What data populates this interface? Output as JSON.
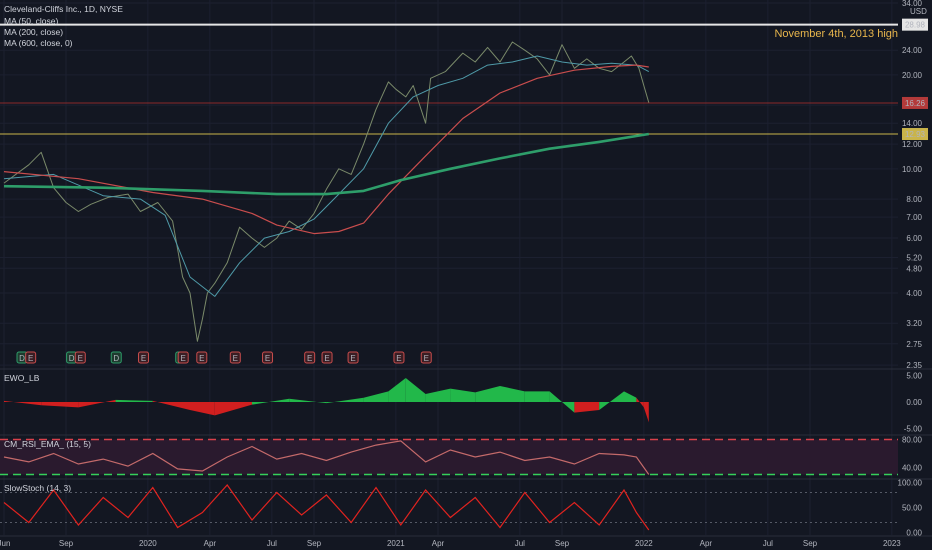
{
  "main": {
    "title": "Cleveland-Cliffs Inc., 1D, NYSE",
    "indicators": [
      "MA (50, close)",
      "MA (200, close)",
      "MA (600, close, 0)"
    ],
    "currency": "USD",
    "annotation": "November 4th, 2013 high",
    "price_tags": {
      "high_line": "28.98",
      "current": "16.26",
      "support": "12.93"
    },
    "event_markers": [
      {
        "t": 0.0,
        "label": "D"
      },
      {
        "t": 0.035,
        "label": "E"
      },
      {
        "t": 0.2,
        "label": "D"
      },
      {
        "t": 0.235,
        "label": "E"
      },
      {
        "t": 0.38,
        "label": "D"
      },
      {
        "t": 0.49,
        "label": "E"
      },
      {
        "t": 0.64,
        "label": "D"
      },
      {
        "t": 0.65,
        "label": "E"
      },
      {
        "t": 0.725,
        "label": "E"
      },
      {
        "t": 0.86,
        "label": "E"
      },
      {
        "t": 0.99,
        "label": "E"
      },
      {
        "t": 1.16,
        "label": "E"
      },
      {
        "t": 1.23,
        "label": "E"
      },
      {
        "t": 1.335,
        "label": "E"
      },
      {
        "t": 1.52,
        "label": "E"
      },
      {
        "t": 1.63,
        "label": "E"
      }
    ]
  },
  "panes": [
    {
      "title": "EWO_LB",
      "ticks": [
        "5.00",
        "0.00",
        "-5.00"
      ]
    },
    {
      "title": "CM_RSI_EMA_ (15, 5)",
      "ticks": [
        "80.00",
        "40.00"
      ]
    },
    {
      "title": "SlowStoch (14, 3)",
      "ticks": [
        "100.00",
        "50.00",
        "0.00"
      ]
    }
  ],
  "time_axis": [
    {
      "t": 0.0,
      "label": "Jun"
    },
    {
      "t": 0.25,
      "label": "Sep"
    },
    {
      "t": 0.58,
      "label": "2020"
    },
    {
      "t": 0.83,
      "label": "Apr"
    },
    {
      "t": 1.08,
      "label": "Jul"
    },
    {
      "t": 1.25,
      "label": "Sep"
    },
    {
      "t": 1.58,
      "label": "2021"
    },
    {
      "t": 1.75,
      "label": "Apr"
    },
    {
      "t": 2.08,
      "label": "Jul"
    },
    {
      "t": 2.25,
      "label": "Sep"
    },
    {
      "t": 2.58,
      "label": "2022"
    },
    {
      "t": 2.83,
      "label": "Apr"
    },
    {
      "t": 3.08,
      "label": "Jul"
    },
    {
      "t": 3.25,
      "label": "Sep"
    },
    {
      "t": 3.58,
      "label": "2023"
    }
  ],
  "chart_data": {
    "type": "line",
    "title": "Cleveland-Cliffs Inc., 1D, NYSE",
    "log_scale": true,
    "ylim": [
      2.3,
      34.0
    ],
    "y_ticks": [
      "34.00",
      "24.00",
      "20.00",
      "16.00",
      "14.00",
      "12.00",
      "10.00",
      "8.00",
      "7.00",
      "6.00",
      "5.20",
      "4.80",
      "4.00",
      "3.20",
      "2.75",
      "2.35"
    ],
    "y_tick_values": [
      34,
      24,
      20,
      16,
      14,
      12,
      10,
      8,
      7,
      6,
      5.2,
      4.8,
      4,
      3.2,
      2.75,
      2.35
    ],
    "x_unit": "years since Jun 2019",
    "horizontal_lines": [
      {
        "value": 28.98,
        "color": "#e6e6e6"
      },
      {
        "value": 16.26,
        "color": "#8b2a2a"
      },
      {
        "value": 12.93,
        "color": "#c9b44a"
      }
    ],
    "series": [
      {
        "name": "Price",
        "color": "#7a8a6a",
        "t": [
          0,
          0.1,
          0.15,
          0.2,
          0.25,
          0.3,
          0.35,
          0.42,
          0.5,
          0.55,
          0.62,
          0.68,
          0.72,
          0.75,
          0.78,
          0.8,
          0.82,
          0.85,
          0.9,
          0.95,
          1.0,
          1.05,
          1.1,
          1.15,
          1.2,
          1.25,
          1.3,
          1.35,
          1.4,
          1.45,
          1.5,
          1.55,
          1.58,
          1.62,
          1.65,
          1.7,
          1.72,
          1.78,
          1.85,
          1.9,
          1.95,
          2.0,
          2.05,
          2.1,
          2.15,
          2.2,
          2.25,
          2.3,
          2.35,
          2.4,
          2.45,
          2.5,
          2.53,
          2.56,
          2.58,
          2.6
        ],
        "values": [
          9.0,
          10.3,
          11.3,
          8.7,
          7.8,
          7.3,
          7.7,
          8.1,
          8.3,
          7.3,
          7.8,
          6.8,
          4.5,
          4.0,
          2.8,
          3.3,
          4.0,
          4.3,
          5.0,
          6.5,
          6.0,
          5.6,
          6.0,
          6.8,
          6.4,
          7.2,
          8.6,
          10.0,
          9.6,
          12.0,
          15.5,
          19.0,
          18.0,
          17.0,
          18.5,
          14.0,
          19.5,
          20.5,
          23.5,
          22.0,
          24.5,
          22.0,
          25.5,
          24.0,
          22.5,
          20.0,
          25.0,
          21.0,
          22.5,
          21.0,
          20.5,
          22.0,
          23.0,
          21.0,
          18.5,
          16.3
        ]
      },
      {
        "name": "MA (50, close)",
        "color": "#4f9aa8",
        "t": [
          0,
          0.2,
          0.4,
          0.55,
          0.65,
          0.75,
          0.85,
          0.95,
          1.05,
          1.15,
          1.25,
          1.35,
          1.45,
          1.55,
          1.65,
          1.75,
          1.85,
          1.95,
          2.05,
          2.15,
          2.25,
          2.35,
          2.45,
          2.55,
          2.6
        ],
        "values": [
          9.3,
          9.6,
          8.2,
          8.0,
          7.1,
          4.5,
          3.9,
          5.0,
          6.0,
          6.3,
          6.9,
          8.3,
          10.0,
          14.0,
          17.0,
          18.5,
          19.5,
          21.5,
          22.0,
          23.0,
          22.0,
          21.5,
          21.8,
          21.5,
          20.5
        ]
      },
      {
        "name": "MA (200, close)",
        "color": "#c94d4d",
        "t": [
          0,
          0.3,
          0.6,
          0.8,
          1.0,
          1.1,
          1.25,
          1.35,
          1.45,
          1.55,
          1.7,
          1.85,
          2.0,
          2.15,
          2.3,
          2.45,
          2.55,
          2.6
        ],
        "values": [
          9.8,
          9.3,
          8.4,
          8.0,
          7.2,
          6.6,
          6.2,
          6.3,
          6.7,
          8.3,
          11.0,
          14.5,
          17.5,
          19.5,
          20.7,
          21.3,
          21.5,
          21.2
        ]
      },
      {
        "name": "MA (600, close, 0)",
        "color": "#2e9e6a",
        "t": [
          0,
          0.4,
          0.8,
          1.1,
          1.3,
          1.45,
          1.6,
          1.8,
          2.0,
          2.2,
          2.4,
          2.6
        ],
        "values": [
          8.8,
          8.7,
          8.5,
          8.3,
          8.3,
          8.5,
          9.2,
          10.0,
          10.8,
          11.6,
          12.2,
          12.93
        ]
      }
    ],
    "EWO_LB": {
      "t": [
        0,
        0.15,
        0.3,
        0.45,
        0.6,
        0.75,
        0.85,
        1.0,
        1.15,
        1.3,
        1.45,
        1.55,
        1.62,
        1.7,
        1.8,
        1.9,
        2.0,
        2.1,
        2.2,
        2.3,
        2.4,
        2.5,
        2.55,
        2.58,
        2.6
      ],
      "values": [
        0.2,
        -0.6,
        -1.0,
        0.4,
        0.2,
        -1.5,
        -2.5,
        -0.5,
        0.6,
        -0.2,
        0.8,
        2.0,
        4.5,
        1.5,
        2.5,
        1.8,
        3.0,
        2.0,
        2.0,
        -2.0,
        -1.5,
        2.0,
        0.8,
        -1.0,
        -3.8
      ]
    },
    "CM_RSI_EMA_": {
      "t": [
        0,
        0.1,
        0.2,
        0.3,
        0.4,
        0.5,
        0.6,
        0.7,
        0.8,
        0.9,
        1.0,
        1.1,
        1.2,
        1.3,
        1.4,
        1.5,
        1.6,
        1.7,
        1.8,
        1.9,
        2.0,
        2.1,
        2.2,
        2.3,
        2.4,
        2.5,
        2.55,
        2.6
      ],
      "values": [
        55,
        48,
        60,
        45,
        52,
        42,
        60,
        38,
        35,
        55,
        70,
        52,
        60,
        50,
        62,
        72,
        78,
        48,
        65,
        55,
        62,
        50,
        55,
        45,
        60,
        58,
        55,
        30
      ]
    },
    "SlowStoch": {
      "t": [
        0,
        0.1,
        0.2,
        0.3,
        0.4,
        0.5,
        0.6,
        0.7,
        0.8,
        0.9,
        1.0,
        1.1,
        1.2,
        1.3,
        1.4,
        1.5,
        1.6,
        1.7,
        1.8,
        1.9,
        2.0,
        2.1,
        2.2,
        2.3,
        2.4,
        2.5,
        2.55,
        2.6
      ],
      "values": [
        60,
        20,
        85,
        15,
        70,
        30,
        90,
        10,
        40,
        95,
        25,
        80,
        35,
        75,
        20,
        90,
        15,
        85,
        30,
        70,
        10,
        80,
        20,
        60,
        15,
        85,
        40,
        5
      ]
    }
  }
}
